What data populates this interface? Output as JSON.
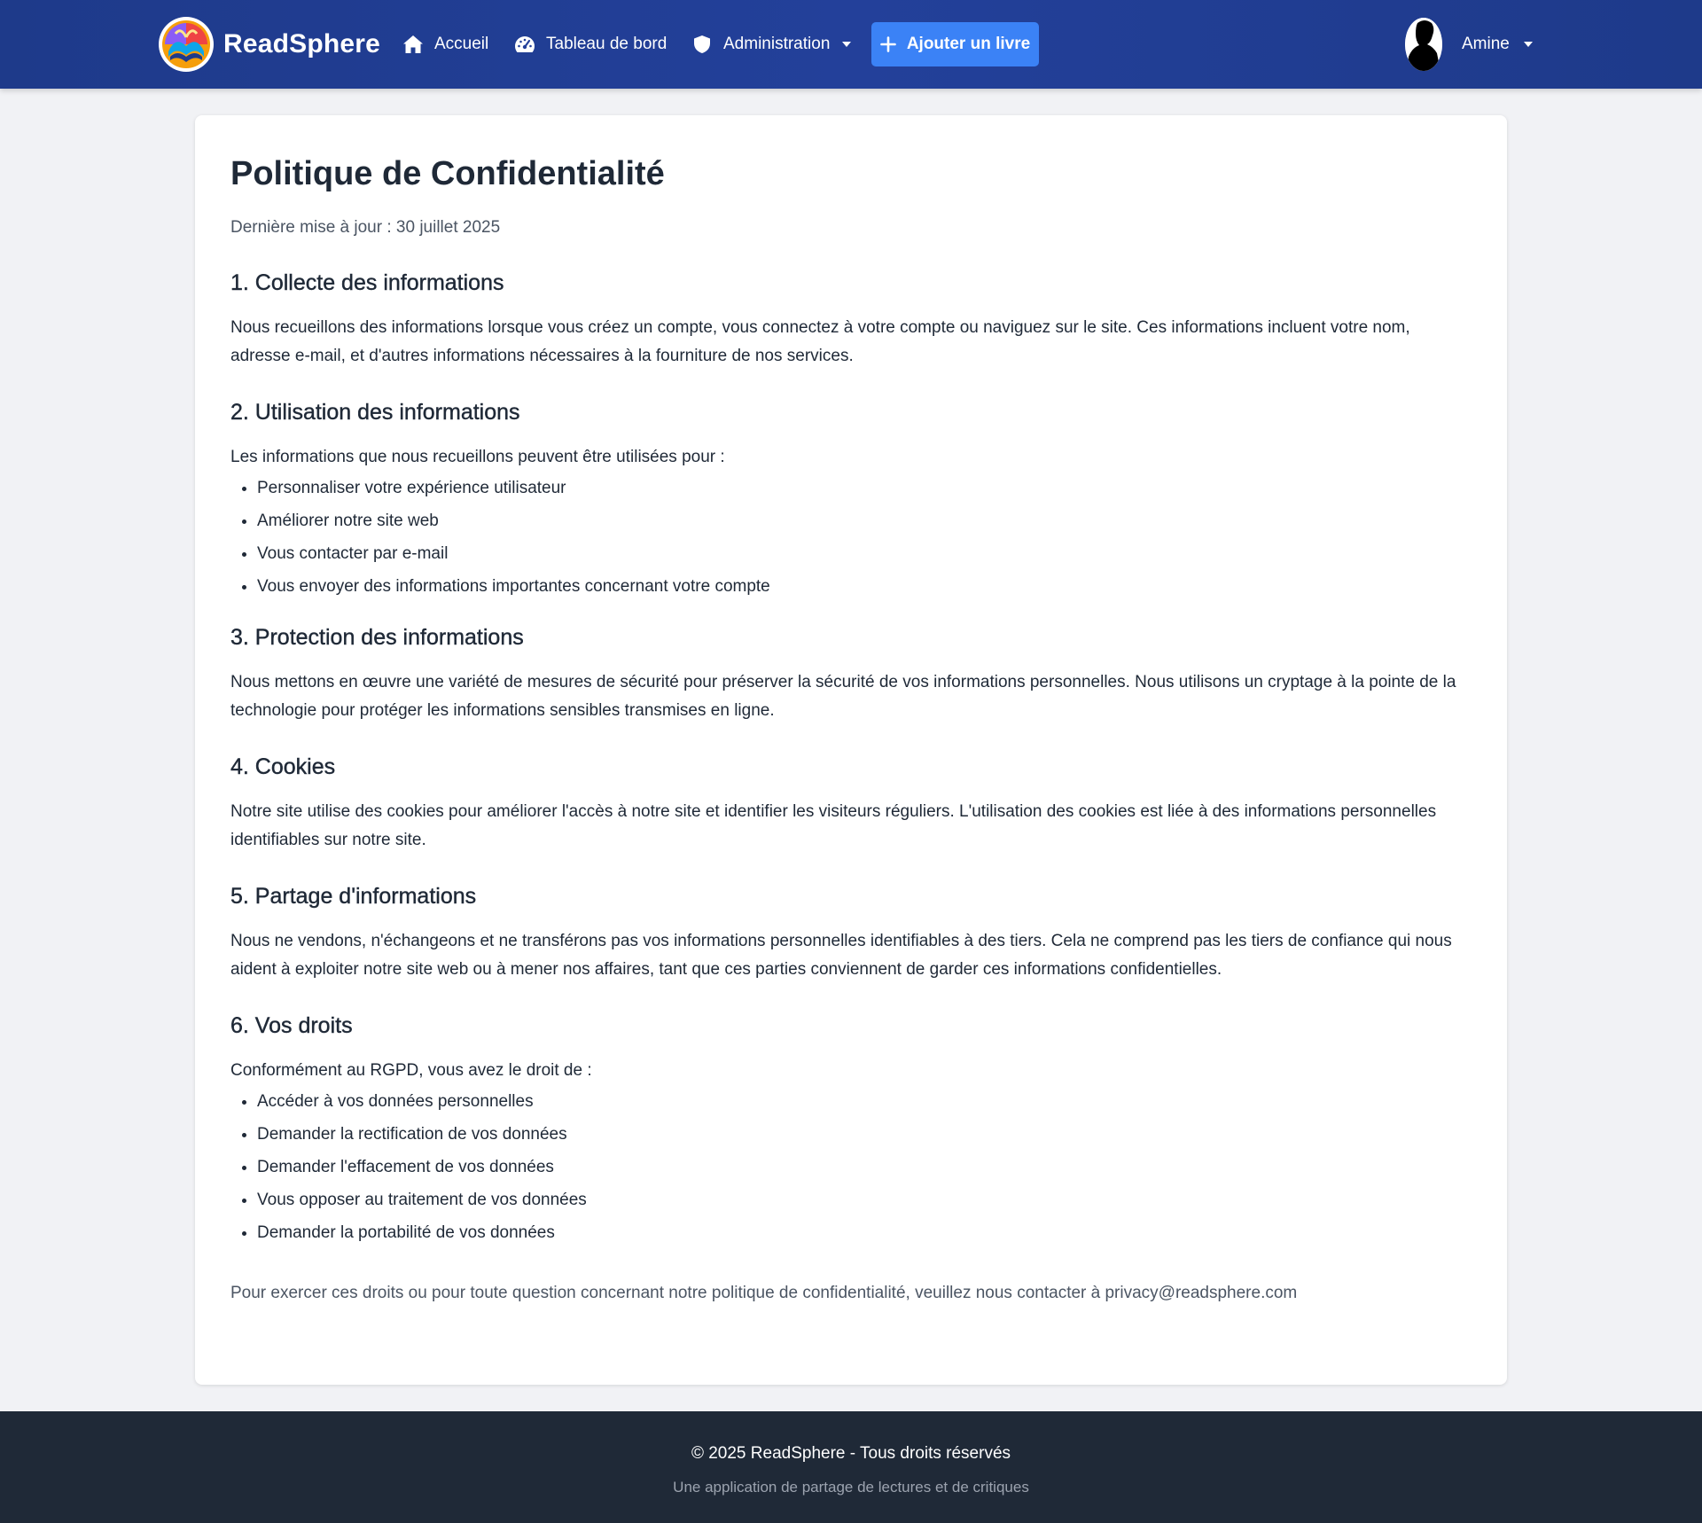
{
  "brand": {
    "name": "ReadSphere",
    "logo_icon": "readsphere-logo-icon"
  },
  "nav": {
    "home": {
      "label": "Accueil",
      "icon": "home-icon"
    },
    "dashboard": {
      "label": "Tableau de bord",
      "icon": "gauge-icon"
    },
    "admin": {
      "label": "Administration",
      "icon": "shield-icon"
    },
    "add_book": {
      "label": "Ajouter un livre",
      "icon": "plus-icon"
    },
    "user": {
      "name": "Amine",
      "icon": "avatar-silhouette"
    }
  },
  "colors": {
    "navbar": "#1e3a8a",
    "accent_button": "#3b82f6",
    "page_background": "#f1f2f5",
    "footer": "#1f2937"
  },
  "page": {
    "title": "Politique de Confidentialité",
    "updated": "Dernière mise à jour : 30 juillet 2025",
    "sections": [
      {
        "title": "1. Collecte des informations",
        "text": "Nous recueillons des informations lorsque vous créez un compte, vous connectez à votre compte ou naviguez sur le site. Ces informations incluent votre nom, adresse e-mail, et d'autres informations nécessaires à la fourniture de nos services."
      },
      {
        "title": "2. Utilisation des informations",
        "text": "Les informations que nous recueillons peuvent être utilisées pour :",
        "items": [
          "Personnaliser votre expérience utilisateur",
          "Améliorer notre site web",
          "Vous contacter par e-mail",
          "Vous envoyer des informations importantes concernant votre compte"
        ]
      },
      {
        "title": "3. Protection des informations",
        "text": "Nous mettons en œuvre une variété de mesures de sécurité pour préserver la sécurité de vos informations personnelles. Nous utilisons un cryptage à la pointe de la technologie pour protéger les informations sensibles transmises en ligne."
      },
      {
        "title": "4. Cookies",
        "text": "Notre site utilise des cookies pour améliorer l'accès à notre site et identifier les visiteurs réguliers. L'utilisation des cookies est liée à des informations personnelles identifiables sur notre site."
      },
      {
        "title": "5. Partage d'informations",
        "text": "Nous ne vendons, n'échangeons et ne transférons pas vos informations personnelles identifiables à des tiers. Cela ne comprend pas les tiers de confiance qui nous aident à exploiter notre site web ou à mener nos affaires, tant que ces parties conviennent de garder ces informations confidentielles."
      },
      {
        "title": "6. Vos droits",
        "text": "Conformément au RGPD, vous avez le droit de :",
        "items": [
          "Accéder à vos données personnelles",
          "Demander la rectification de vos données",
          "Demander l'effacement de vos données",
          "Vous opposer au traitement de vos données",
          "Demander la portabilité de vos données"
        ]
      }
    ],
    "contact": "Pour exercer ces droits ou pour toute question concernant notre politique de confidentialité, veuillez nous contacter à privacy@readsphere.com"
  },
  "footer": {
    "copyright": "© 2025 ReadSphere - Tous droits réservés",
    "tagline": "Une application de partage de lectures et de critiques"
  }
}
